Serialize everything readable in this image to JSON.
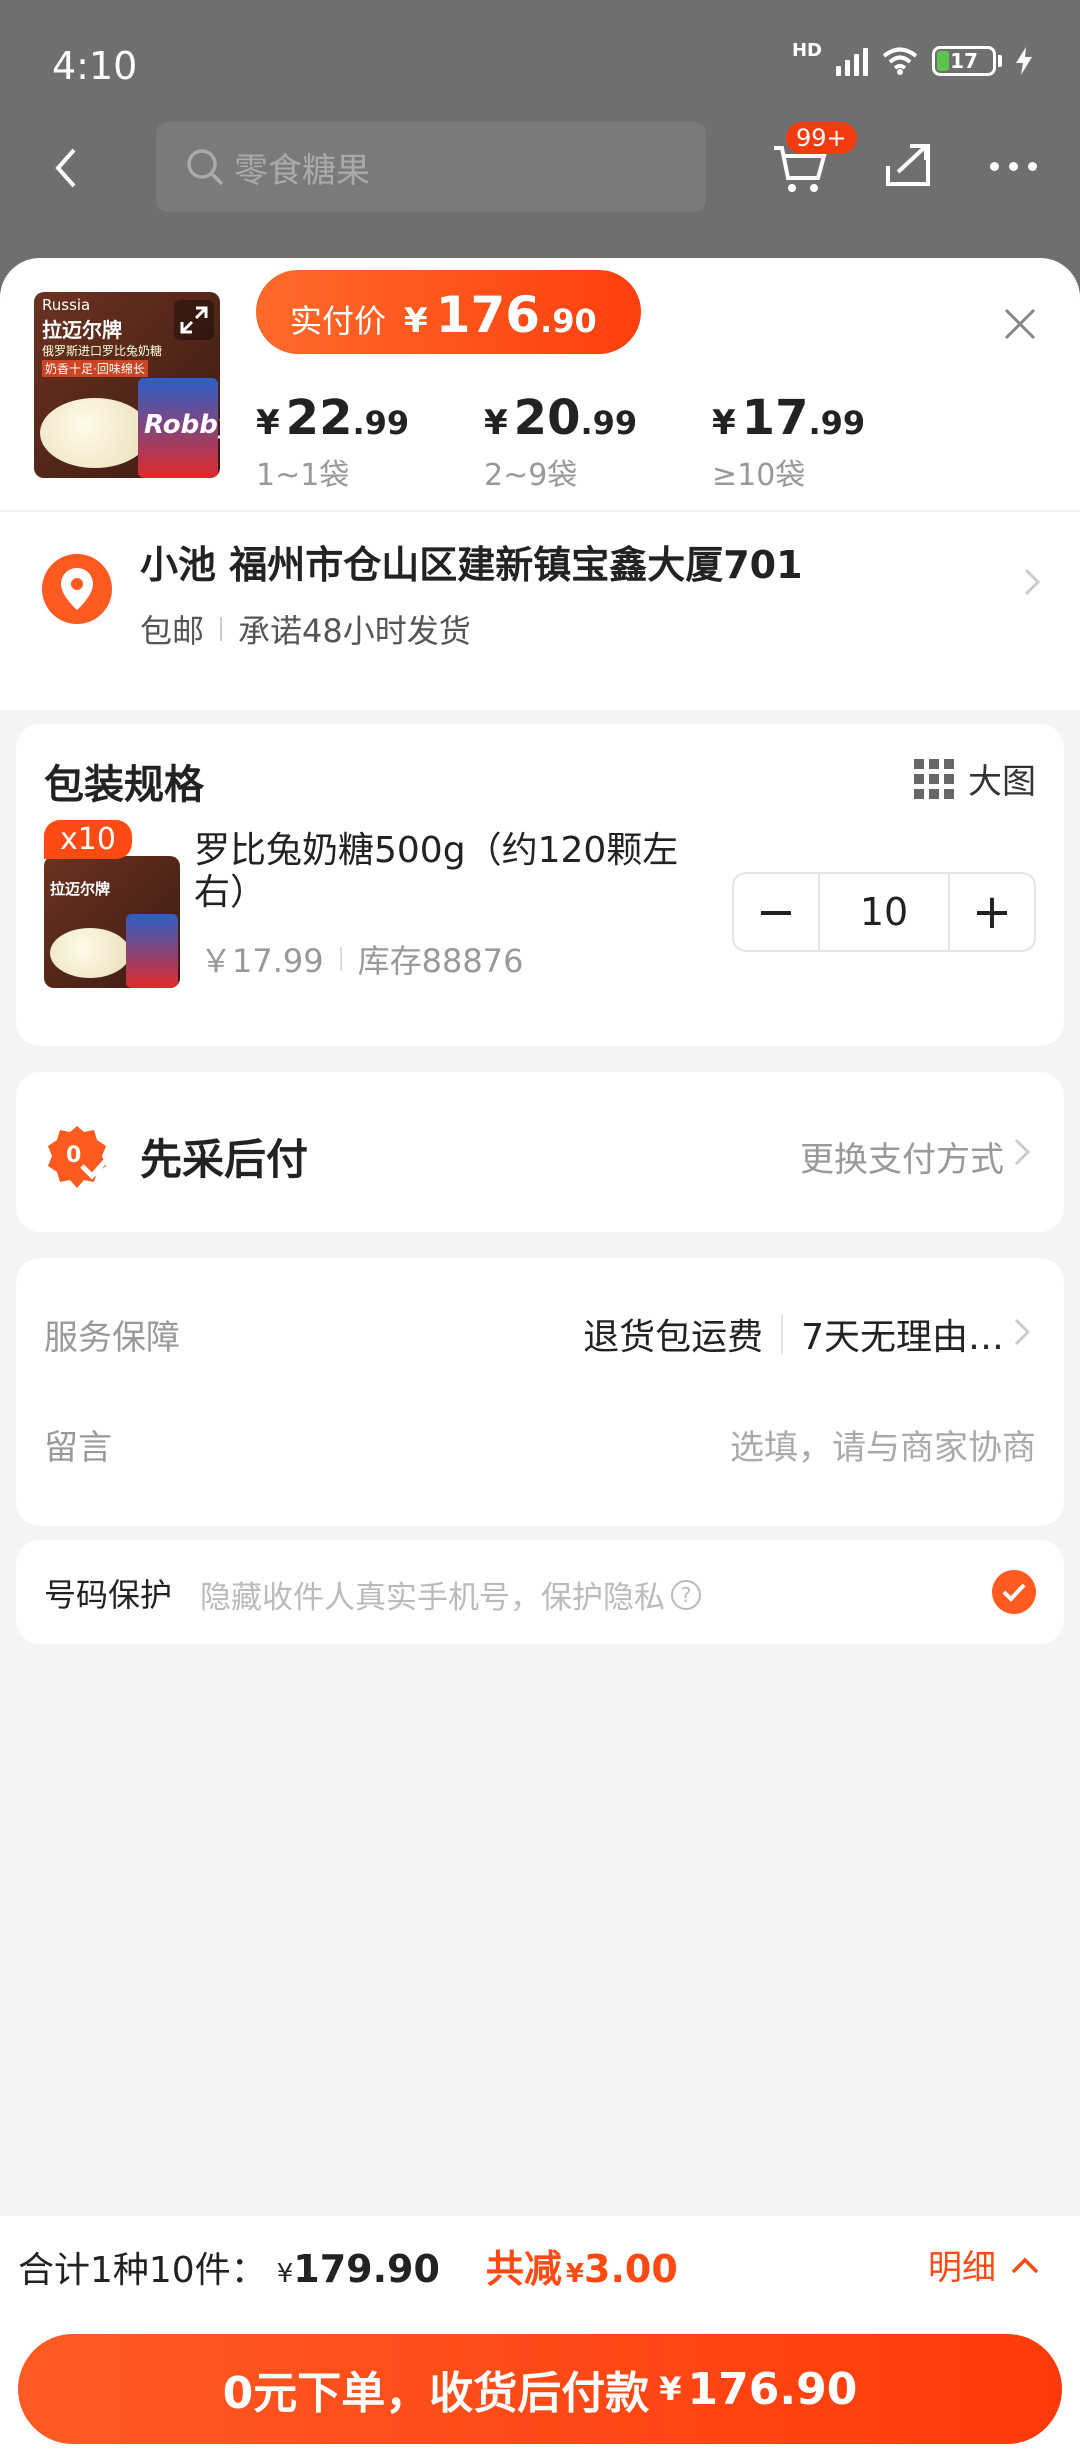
{
  "status": {
    "time": "4:10",
    "hd": "HD",
    "battery": "17"
  },
  "topbar": {
    "search_placeholder": "零食糖果",
    "cart_badge": "99+"
  },
  "sheet": {
    "pay_label": "实付价",
    "pay_currency": "¥",
    "pay_int": "176",
    "pay_dec": ".90",
    "tiers": [
      {
        "cur": "¥",
        "int": "22",
        "dec": ".99",
        "qty": "1~1袋"
      },
      {
        "cur": "¥",
        "int": "20",
        "dec": ".99",
        "qty": "2~9袋"
      },
      {
        "cur": "¥",
        "int": "17",
        "dec": ".99",
        "qty": "≥10袋"
      }
    ],
    "thumb": {
      "origin": "Russia",
      "brand": "拉迈尔牌",
      "line1": "俄罗斯进口罗比兔奶糖",
      "line2": "奶香十足·回味绵长",
      "product": "Robby"
    }
  },
  "address": {
    "line1": "小池 福州市仓山区建新镇宝鑫大厦701",
    "shipping": "包邮",
    "promise": "承诺48小时发货"
  },
  "spec": {
    "title": "包装规格",
    "big_pic": "大图",
    "qty_tag": "x10",
    "product_name": "罗比兔奶糖500g（约120颗左右）",
    "unit_price": "￥17.99",
    "stock": "库存88876",
    "quantity": "10",
    "minus": "−",
    "plus": "+"
  },
  "paylater": {
    "label": "先采后付",
    "change": "更换支付方式"
  },
  "service": {
    "label": "服务保障",
    "item1": "退货包运费",
    "item2": "7天无理由…",
    "note_label": "留言",
    "note_placeholder": "选填，请与商家协商"
  },
  "protect": {
    "label": "号码保护",
    "hint": "隐藏收件人真实手机号，保护隐私",
    "q": "?"
  },
  "footer": {
    "summary": "合计1种10件：",
    "total_cur": "¥",
    "total": "179.90",
    "discount_label": "共减",
    "discount_cur": "¥",
    "discount": "3.00",
    "detail": "明细",
    "cta_text": "0元下单，收货后付款",
    "cta_cur": "¥",
    "cta_amount": "176.90"
  },
  "colors": {
    "accent": "#ff4a14",
    "dim": "#6f6f6f"
  }
}
